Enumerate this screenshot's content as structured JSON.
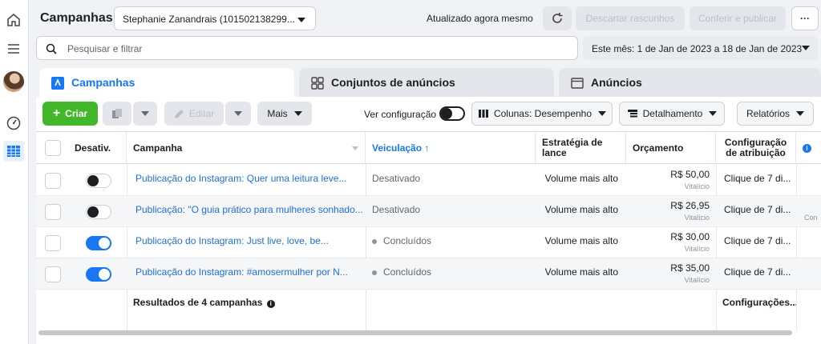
{
  "header": {
    "title": "Campanhas",
    "account_selector": "Stephanie Zanandrais (101502138299...",
    "updated_status": "Atualizado agora mesmo",
    "discard_label": "Descartar rascunhos",
    "review_label": "Conferir e publicar",
    "more_label": "···"
  },
  "search": {
    "placeholder": "Pesquisar e filtrar"
  },
  "date_range": "Este mês: 1 de Jan de 2023 a 18 de Jan de 2023",
  "tabs": [
    {
      "label": "Campanhas",
      "active": true
    },
    {
      "label": "Conjuntos de anúncios",
      "active": false
    },
    {
      "label": "Anúncios",
      "active": false
    }
  ],
  "toolbar": {
    "create_label": "Criar",
    "edit_label": "Editar",
    "more_label": "Mais",
    "view_setup_label": "Ver configuração",
    "columns_label": "Colunas: Desempenho",
    "breakdown_label": "Detalhamento",
    "reports_label": "Relatórios"
  },
  "table": {
    "headers": {
      "status": "Desativ.",
      "campaign": "Campanha",
      "delivery": "Veiculação ↑",
      "bid_strategy": "Estratégia de lance",
      "budget": "Orçamento",
      "attribution": "Configuração de atribuição"
    },
    "rows": [
      {
        "on": false,
        "campaign": "Publicação do Instagram: Quer uma leitura leve...",
        "delivery": "Desativado",
        "delivery_dot": false,
        "bid": "Volume mais alto",
        "budget": "R$ 50,00",
        "budget_type": "Vitalício",
        "attribution": "Clique de 7 di..."
      },
      {
        "on": false,
        "campaign": "Publicação: \"O guia prático para mulheres sonhado...",
        "delivery": "Desativado",
        "delivery_dot": false,
        "bid": "Volume mais alto",
        "budget": "R$ 26,95",
        "budget_type": "Vitalício",
        "attribution": "Clique de 7 di...",
        "extra": "Con"
      },
      {
        "on": true,
        "campaign": "Publicação do Instagram: Just live, love, be...",
        "delivery": "Concluídos",
        "delivery_dot": true,
        "bid": "Volume mais alto",
        "budget": "R$ 30,00",
        "budget_type": "Vitalício",
        "attribution": "Clique de 7 di..."
      },
      {
        "on": true,
        "campaign": "Publicação do Instagram: #amosermulher por N...",
        "delivery": "Concluídos",
        "delivery_dot": true,
        "bid": "Volume mais alto",
        "budget": "R$ 35,00",
        "budget_type": "Vitalício",
        "attribution": "Clique de 7 di..."
      }
    ],
    "footer": {
      "results": "Resultados de 4 campanhas",
      "attribution": "Configurações..."
    }
  },
  "colors": {
    "accent": "#1877f2",
    "create_green": "#42b72a",
    "link": "#216fdb"
  }
}
